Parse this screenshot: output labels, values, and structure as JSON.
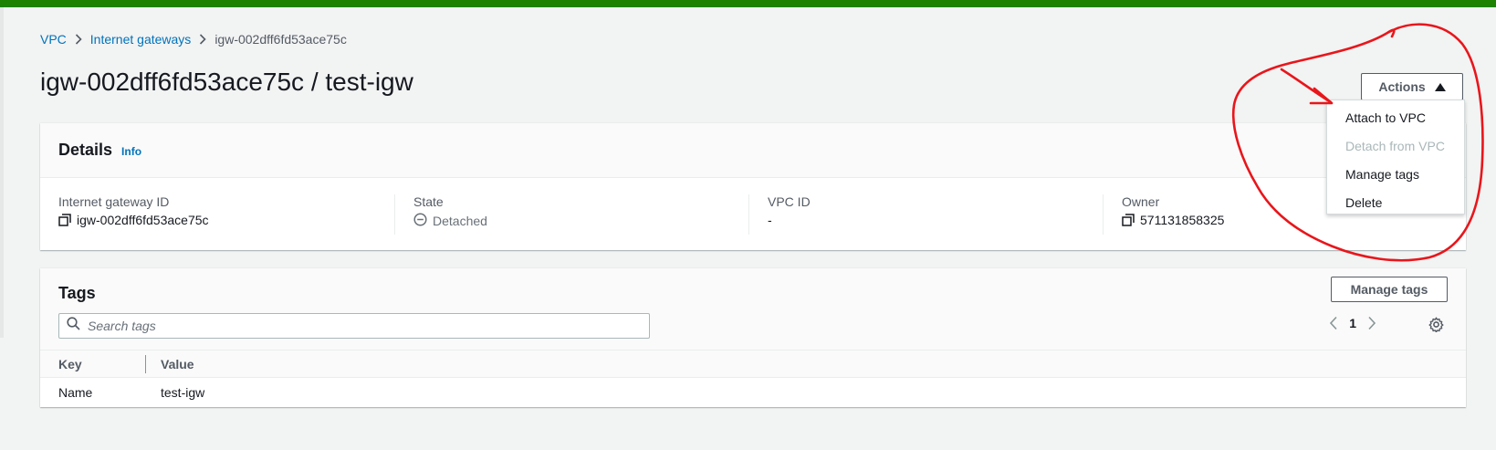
{
  "colors": {
    "top_bar": "#1d8102",
    "link": "#0073bb",
    "annotation": "#e8161b"
  },
  "breadcrumb": {
    "items": [
      "VPC",
      "Internet gateways"
    ],
    "current": "igw-002dff6fd53ace75c"
  },
  "page": {
    "title": "igw-002dff6fd53ace75c / test-igw"
  },
  "actions": {
    "label": "Actions",
    "menu": [
      {
        "label": "Attach to VPC",
        "disabled": false
      },
      {
        "label": "Detach from VPC",
        "disabled": true
      },
      {
        "label": "Manage tags",
        "disabled": false
      },
      {
        "label": "Delete",
        "disabled": false
      }
    ]
  },
  "details": {
    "title": "Details",
    "info": "Info",
    "fields": [
      {
        "label": "Internet gateway ID",
        "value": "igw-002dff6fd53ace75c",
        "icon": "copy-icon"
      },
      {
        "label": "State",
        "value": "Detached",
        "icon": "minus-circle-icon"
      },
      {
        "label": "VPC ID",
        "value": "-"
      },
      {
        "label": "Owner",
        "value": "571131858325",
        "icon": "copy-icon"
      }
    ]
  },
  "tags": {
    "title": "Tags",
    "manage_label": "Manage tags",
    "search_placeholder": "Search tags",
    "page": "1",
    "columns": {
      "key": "Key",
      "value": "Value"
    },
    "rows": [
      {
        "key": "Name",
        "value": "test-igw"
      }
    ]
  }
}
